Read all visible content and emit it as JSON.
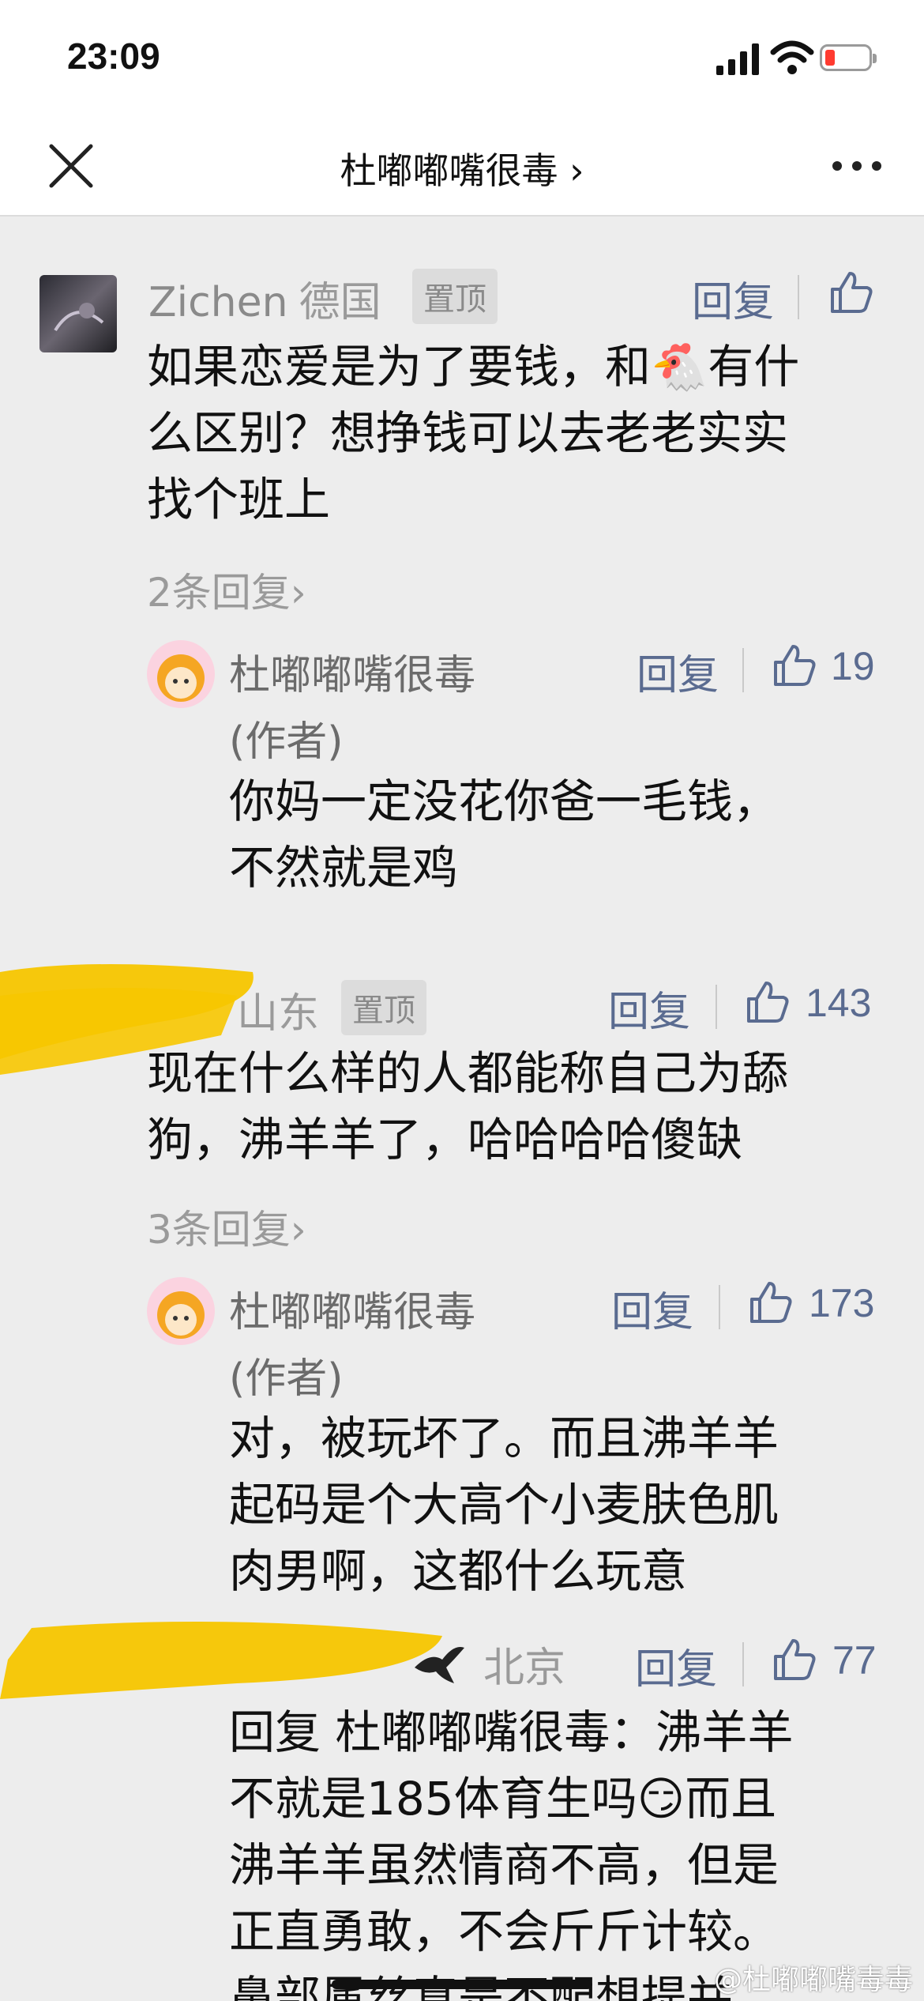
{
  "status": {
    "time": "23:09"
  },
  "nav": {
    "title": "杜嘟嘟嘴很毒 ›"
  },
  "comments": [
    {
      "name": "Zichen",
      "location": "德国",
      "pin": "置顶",
      "reply": "回复",
      "text": [
        "如果恋爱是为了要钱，和🐔有什",
        "么区别？想挣钱可以去老老实实",
        "找个班上"
      ],
      "more_replies": "2条回复›",
      "sub": {
        "name": "杜嘟嘟嘴很毒",
        "tag": "(作者)",
        "reply": "回复",
        "likes": "19",
        "text": [
          "你妈一定没花你爸一毛钱，",
          "不然就是鸡"
        ]
      }
    },
    {
      "location": "山东",
      "pin": "置顶",
      "reply": "回复",
      "likes": "143",
      "text": [
        "现在什么样的人都能称自己为舔",
        "狗，沸羊羊了，哈哈哈哈傻缺"
      ],
      "more_replies": "3条回复›",
      "sub": {
        "name": "杜嘟嘟嘴很毒",
        "tag": "(作者)",
        "reply": "回复",
        "likes": "173",
        "text": [
          "对，被玩坏了。而且沸羊羊",
          "起码是个大高个小麦肤色肌",
          "肉男啊，这都什么玩意"
        ]
      },
      "sub2": {
        "location": "北京",
        "reply": "回复",
        "likes": "77",
        "text": [
          "回复 杜嘟嘟嘴很毒：沸羊羊",
          "不就是185体育生吗😏而且",
          "沸羊羊虽然情商不高，但是",
          "正直勇敢，不会斤斤计较。",
          "鼻部属丝真是不配想提并"
        ]
      }
    }
  ],
  "watermark": "@杜嘟嘟嘴毒毒",
  "colors": {
    "accent": "#5a6b90",
    "highlight": "#f7c600"
  }
}
